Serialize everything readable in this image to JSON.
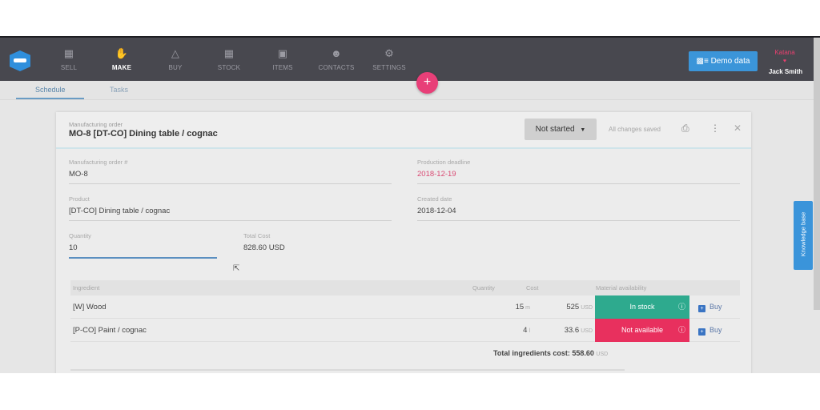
{
  "nav": {
    "items": [
      {
        "label": "SELL",
        "icon": "store-icon",
        "active": false
      },
      {
        "label": "MAKE",
        "icon": "thumbs-icon",
        "active": true
      },
      {
        "label": "BUY",
        "icon": "basket-icon",
        "active": false
      },
      {
        "label": "STOCK",
        "icon": "grid-icon",
        "active": false
      },
      {
        "label": "ITEMS",
        "icon": "ticket-icon",
        "active": false
      },
      {
        "label": "CONTACTS",
        "icon": "people-icon",
        "active": false
      },
      {
        "label": "SETTINGS",
        "icon": "gear-icon",
        "active": false
      }
    ],
    "demo_data_label": "Demo data",
    "company": "Katana",
    "user": "Jack Smith"
  },
  "subtabs": [
    {
      "label": "Schedule",
      "active": true
    },
    {
      "label": "Tasks",
      "active": false
    }
  ],
  "fab_label": "+",
  "order": {
    "caption": "Manufacturing order",
    "title": "MO-8 [DT-CO] Dining table / cognac",
    "status": "Not started",
    "saved_text": "All changes saved",
    "fields": {
      "mo_number": {
        "label": "Manufacturing order #",
        "value": "MO-8"
      },
      "deadline": {
        "label": "Production deadline",
        "value": "2018-12-19"
      },
      "product": {
        "label": "Product",
        "value": "[DT-CO] Dining table / cognac"
      },
      "created": {
        "label": "Created date",
        "value": "2018-12-04"
      },
      "quantity": {
        "label": "Quantity",
        "value": "10"
      },
      "total_cost": {
        "label": "Total Cost",
        "value": "828.60 USD"
      }
    }
  },
  "ingredients": {
    "headers": {
      "ingredient": "Ingredient",
      "quantity": "Quantity",
      "cost": "Cost",
      "availability": "Material availability"
    },
    "rows": [
      {
        "name": "[W] Wood",
        "qty": "15",
        "unit": "m",
        "cost": "525",
        "currency": "USD",
        "availability": "In stock",
        "availability_color": "#2eaa8e",
        "action": "Buy"
      },
      {
        "name": "[P-CO] Paint / cognac",
        "qty": "4",
        "unit": "l",
        "cost": "33.6",
        "currency": "USD",
        "availability": "Not available",
        "availability_color": "#e8305e",
        "action": "Buy"
      }
    ],
    "total_label": "Total ingredients cost: 558.60",
    "total_currency": "USD"
  },
  "knowledge_base_label": "Knowledge base"
}
